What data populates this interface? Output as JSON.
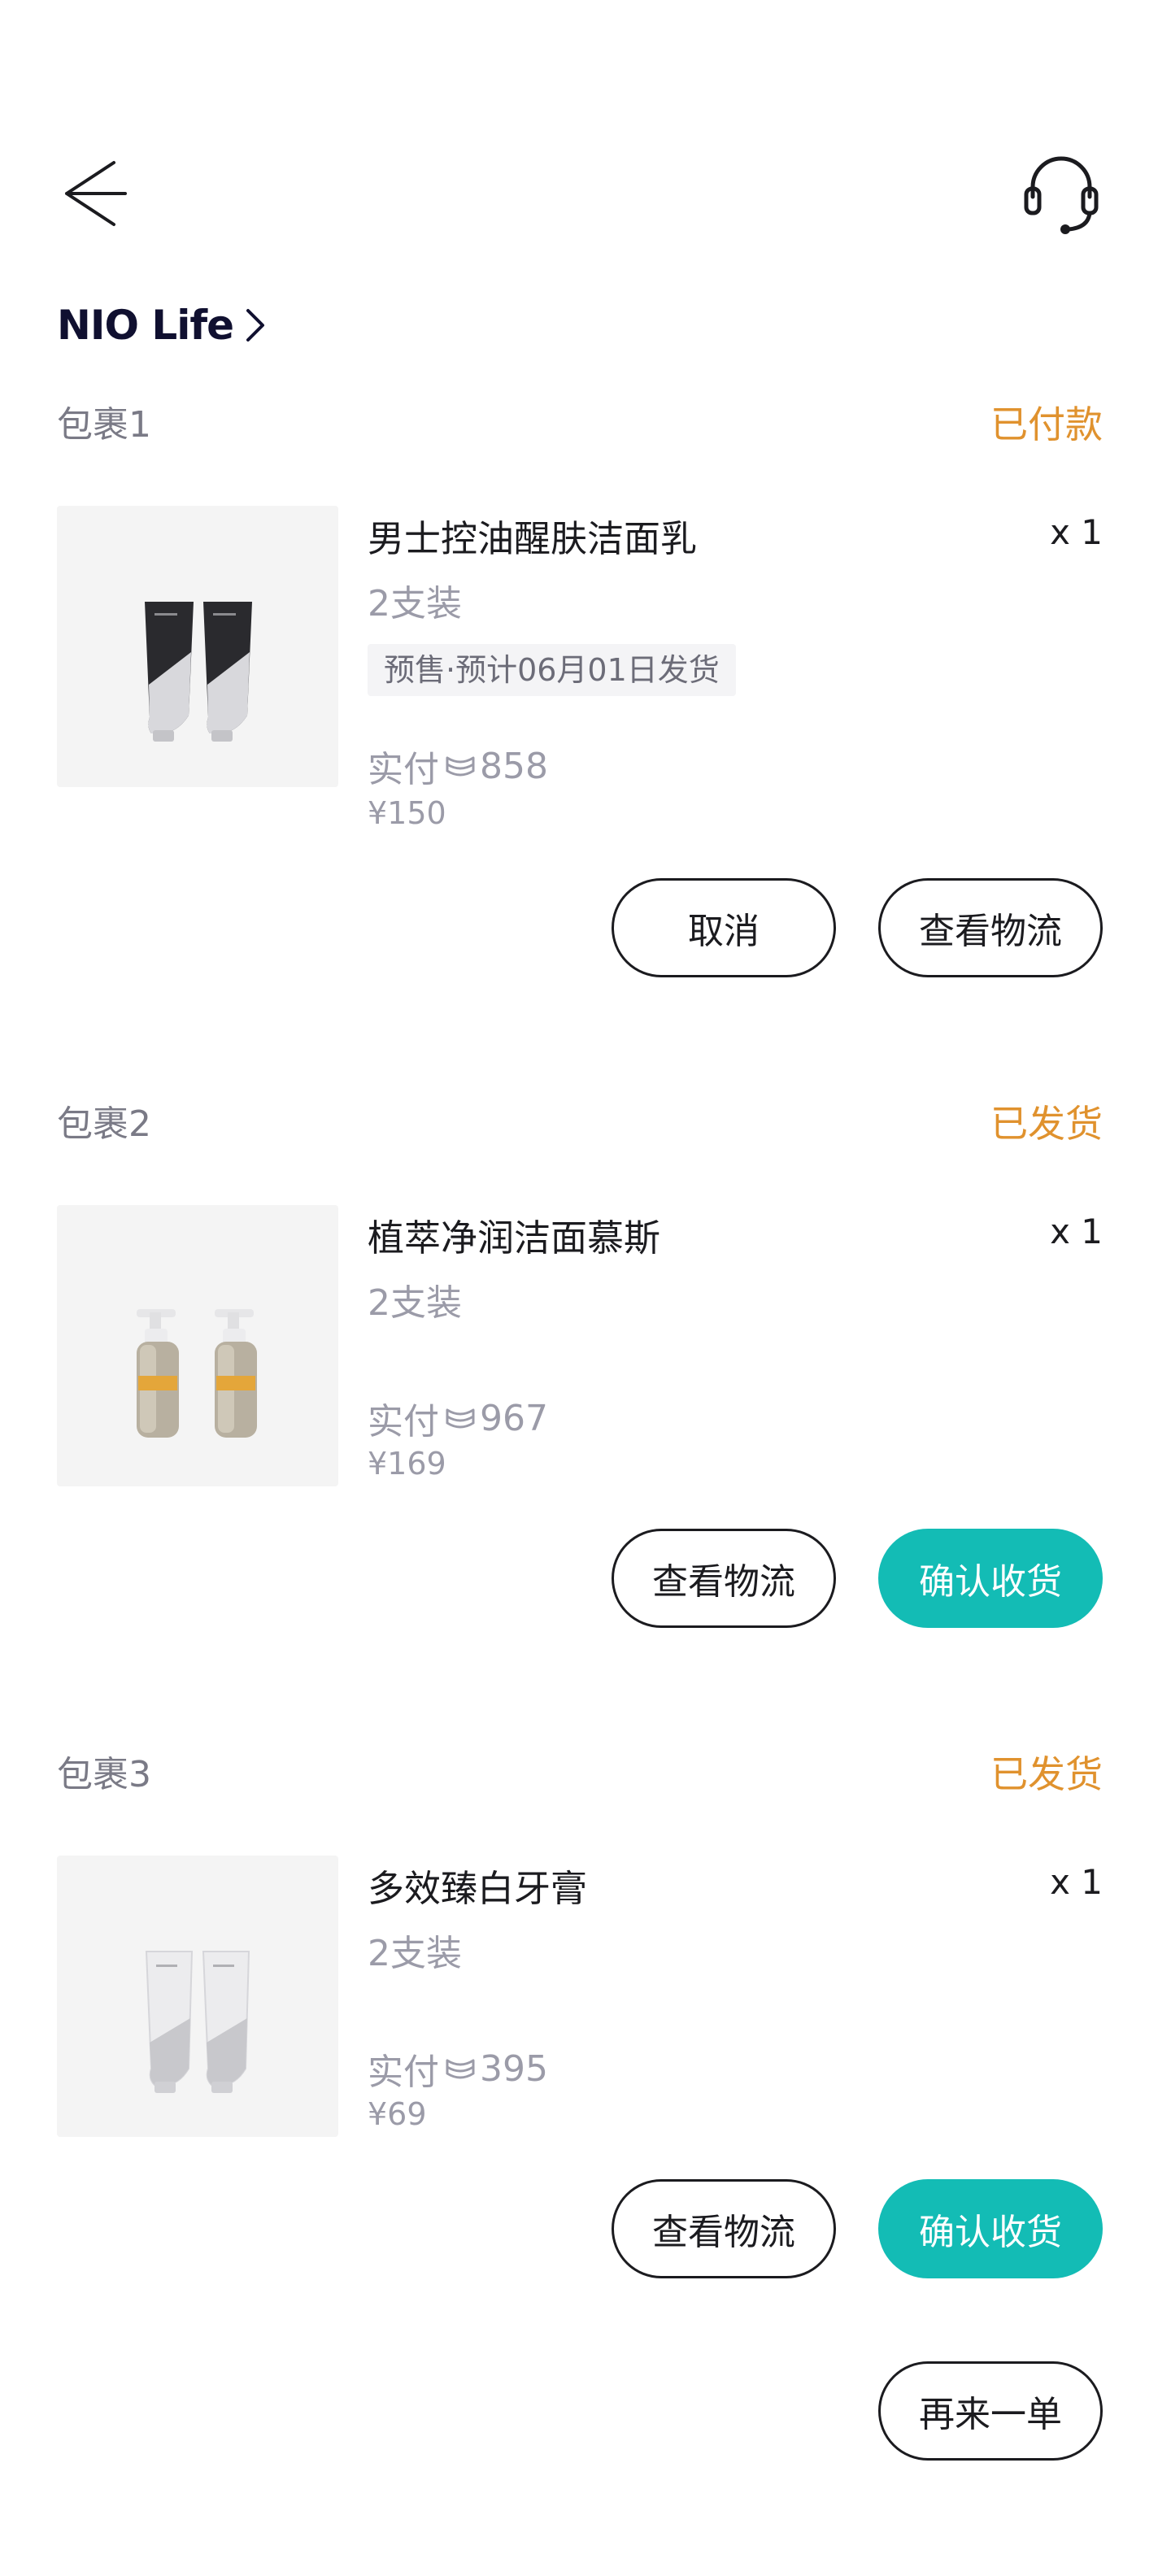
{
  "header": {
    "back_icon": "arrow-left-icon",
    "service_icon": "headset-icon"
  },
  "store": {
    "name": "NIO Life",
    "chevron_icon": "chevron-right-icon"
  },
  "packages": [
    {
      "title": "包裹1",
      "status": "已付款",
      "product_name": "男士控油醒肤洁面乳",
      "quantity": "x 1",
      "spec": "2支装",
      "presale_tag": "预售·预计06月01日发货",
      "paid_prefix": "实付",
      "paid_amount": "858",
      "price": "¥150",
      "actions": [
        "取消",
        "查看物流"
      ]
    },
    {
      "title": "包裹2",
      "status": "已发货",
      "product_name": "植萃净润洁面慕斯",
      "quantity": "x 1",
      "spec": "2支装",
      "paid_prefix": "实付",
      "paid_amount": "967",
      "price": "¥169",
      "actions": [
        "查看物流",
        "确认收货"
      ]
    },
    {
      "title": "包裹3",
      "status": "已发货",
      "product_name": "多效臻白牙膏",
      "quantity": "x 1",
      "spec": "2支装",
      "paid_prefix": "实付",
      "paid_amount": "395",
      "price": "¥69",
      "actions": [
        "查看物流",
        "确认收货"
      ]
    }
  ],
  "footer": {
    "reorder_label": "再来一单"
  },
  "colors": {
    "status_orange": "#e0922e",
    "accent_teal": "#13bcb5",
    "text_dark": "#1b1b1f",
    "text_muted": "#9b9ba8"
  }
}
